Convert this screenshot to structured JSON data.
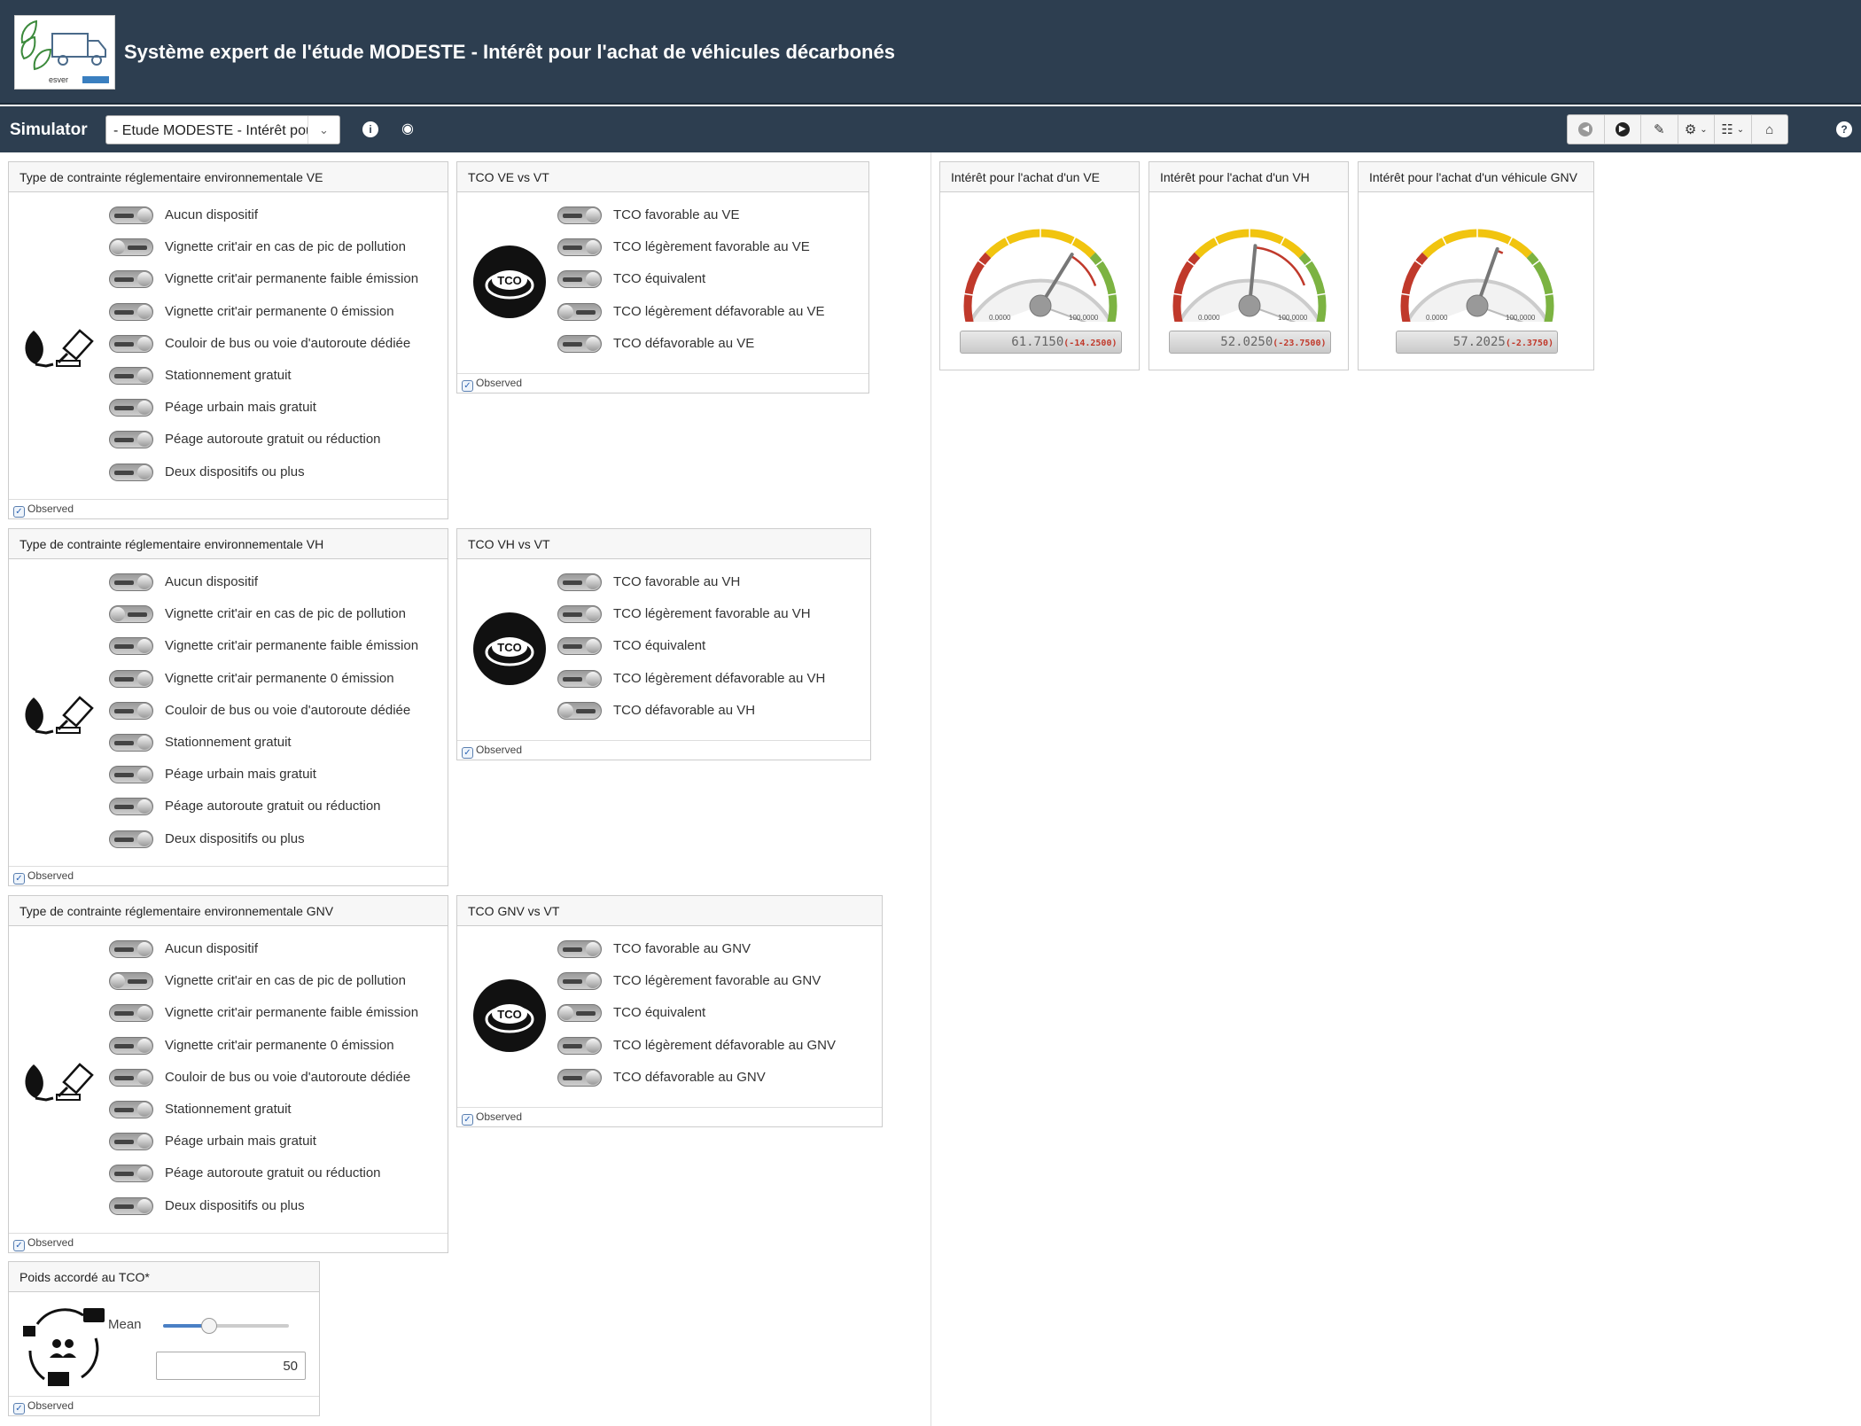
{
  "header": {
    "title": "Système expert de l'étude MODESTE - Intérêt pour l'achat de véhicules décarbonés",
    "logo_text": "esver"
  },
  "toolbar": {
    "simulator_label": "Simulator",
    "model_select_value": "- Etude MODESTE - Intérêt pour l'achat"
  },
  "observed_label": "Observed",
  "constraint_panels": [
    {
      "title": "Type de contrainte réglementaire environnementale VE",
      "states": [
        "Aucun dispositif",
        "Vignette crit'air en cas de pic de pollution",
        "Vignette crit'air permanente faible émission",
        "Vignette crit'air permanente 0 émission",
        "Couloir de bus ou voie d'autoroute dédiée",
        "Stationnement gratuit",
        "Péage urbain mais gratuit",
        "Péage autoroute gratuit ou réduction",
        "Deux dispositifs ou plus"
      ],
      "knobs": [
        "right",
        "left",
        "right",
        "right",
        "right",
        "right",
        "right",
        "right",
        "right"
      ]
    },
    {
      "title": "Type de contrainte réglementaire environnementale VH",
      "states": [
        "Aucun dispositif",
        "Vignette crit'air en cas de pic de pollution",
        "Vignette crit'air permanente faible émission",
        "Vignette crit'air permanente 0 émission",
        "Couloir de bus ou voie d'autoroute dédiée",
        "Stationnement gratuit",
        "Péage urbain mais gratuit",
        "Péage autoroute gratuit ou réduction",
        "Deux dispositifs ou plus"
      ],
      "knobs": [
        "right",
        "left",
        "right",
        "right",
        "right",
        "right",
        "right",
        "right",
        "right"
      ]
    },
    {
      "title": "Type de contrainte réglementaire environnementale GNV",
      "states": [
        "Aucun dispositif",
        "Vignette crit'air en cas de pic de pollution",
        "Vignette crit'air permanente faible émission",
        "Vignette crit'air permanente 0 émission",
        "Couloir de bus ou voie d'autoroute dédiée",
        "Stationnement gratuit",
        "Péage urbain mais gratuit",
        "Péage autoroute gratuit ou réduction",
        "Deux dispositifs ou plus"
      ],
      "knobs": [
        "right",
        "left",
        "right",
        "right",
        "right",
        "right",
        "right",
        "right",
        "right"
      ]
    }
  ],
  "tco_panels": [
    {
      "title": "TCO VE vs VT",
      "icon_text": "TCO",
      "states": [
        "TCO favorable au VE",
        "TCO légèrement favorable au VE",
        "TCO équivalent",
        "TCO légèrement défavorable au VE",
        "TCO défavorable au VE"
      ],
      "knobs": [
        "right",
        "right",
        "right",
        "left",
        "right"
      ]
    },
    {
      "title": "TCO VH vs VT",
      "icon_text": "TCO",
      "states": [
        "TCO favorable au VH",
        "TCO légèrement favorable au VH",
        "TCO équivalent",
        "TCO légèrement défavorable au VH",
        "TCO défavorable au VH"
      ],
      "knobs": [
        "right",
        "right",
        "right",
        "right",
        "left"
      ]
    },
    {
      "title": "TCO GNV vs VT",
      "icon_text": "TCO",
      "states": [
        "TCO favorable au GNV",
        "TCO légèrement favorable au GNV",
        "TCO équivalent",
        "TCO légèrement défavorable au GNV",
        "TCO défavorable au GNV"
      ],
      "knobs": [
        "right",
        "right",
        "left",
        "right",
        "right"
      ]
    }
  ],
  "weight_panel": {
    "title": "Poids accordé au TCO*",
    "slider_label": "Mean",
    "value": "50",
    "slider_fraction": 0.5
  },
  "gauges": [
    {
      "title": "Intérêt pour l'achat d'un VE",
      "min_label": "0.0000",
      "max_label": "100.0000",
      "value": 61.715,
      "value_text": "61.7150",
      "delta_text": "(-14.2500)",
      "previous_value": 75.965
    },
    {
      "title": "Intérêt pour l'achat d'un VH",
      "min_label": "0.0000",
      "max_label": "100.0000",
      "value": 52.025,
      "value_text": "52.0250",
      "delta_text": "(-23.7500)",
      "previous_value": 75.775
    },
    {
      "title": "Intérêt pour l'achat d'un véhicule GNV",
      "min_label": "0.0000",
      "max_label": "100.0000",
      "value": 57.2025,
      "value_text": "57.2025",
      "delta_text": "(-2.3750)",
      "previous_value": 59.5775
    }
  ],
  "colors": {
    "header_bg": "#2d3e50",
    "gauge_red": "#c0392b",
    "gauge_yellow": "#f1c40f",
    "gauge_green": "#7cb342",
    "slider_fill": "#4a80c5"
  }
}
